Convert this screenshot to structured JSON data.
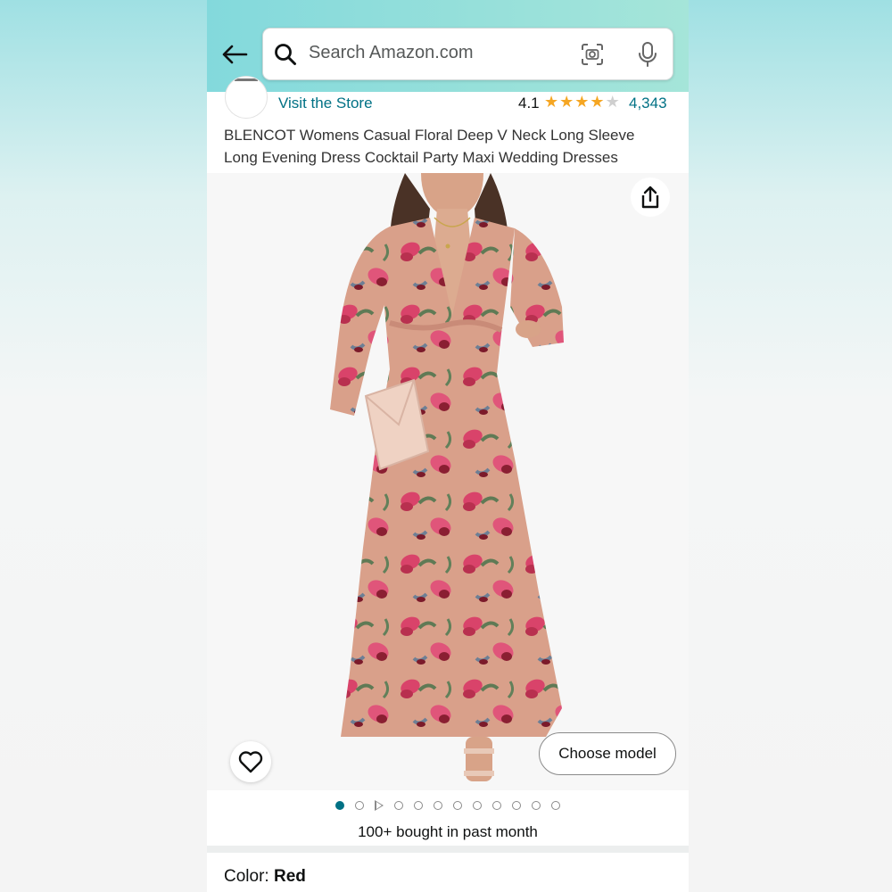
{
  "search": {
    "placeholder": "Search Amazon.com"
  },
  "store": {
    "link_label": "Visit the Store"
  },
  "rating": {
    "value": "4.1",
    "stars": 4.1,
    "max_stars": 5,
    "review_count": "4,343"
  },
  "product": {
    "title": "BLENCOT Womens Casual Floral Deep V Neck Long Sleeve Long Evening Dress Cocktail Party Maxi Wedding Dresses"
  },
  "gallery": {
    "choose_model_label": "Choose model",
    "image_count": 12,
    "active_index": 0,
    "video_index": 2
  },
  "social_proof": {
    "bought_text": "100+ bought in past month"
  },
  "variant": {
    "color_label": "Color: ",
    "color_value": "Red"
  },
  "colors": {
    "link": "#007185",
    "star": "#f5a623",
    "header": "#83d9dc"
  }
}
